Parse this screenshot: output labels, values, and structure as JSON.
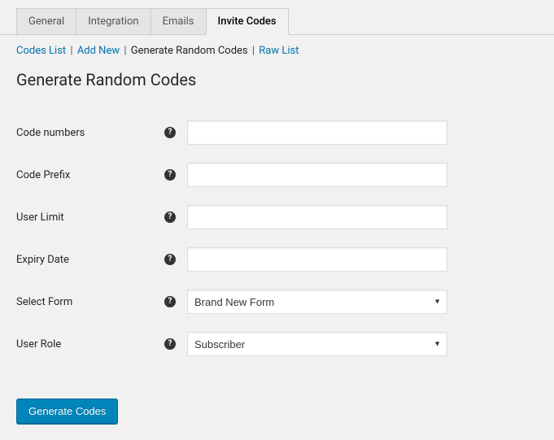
{
  "tabs": {
    "general": "General",
    "integration": "Integration",
    "emails": "Emails",
    "invite_codes": "Invite Codes"
  },
  "subnav": {
    "codes_list": "Codes List",
    "add_new": "Add New",
    "generate_random": "Generate Random Codes",
    "raw_list": "Raw List"
  },
  "page_title": "Generate Random Codes",
  "fields": {
    "code_numbers": {
      "label": "Code numbers",
      "value": ""
    },
    "code_prefix": {
      "label": "Code Prefix",
      "value": ""
    },
    "user_limit": {
      "label": "User Limit",
      "value": ""
    },
    "expiry_date": {
      "label": "Expiry Date",
      "value": ""
    },
    "select_form": {
      "label": "Select Form",
      "selected": "Brand New Form"
    },
    "user_role": {
      "label": "User Role",
      "selected": "Subscriber"
    }
  },
  "help_glyph": "?",
  "submit_label": "Generate Codes"
}
